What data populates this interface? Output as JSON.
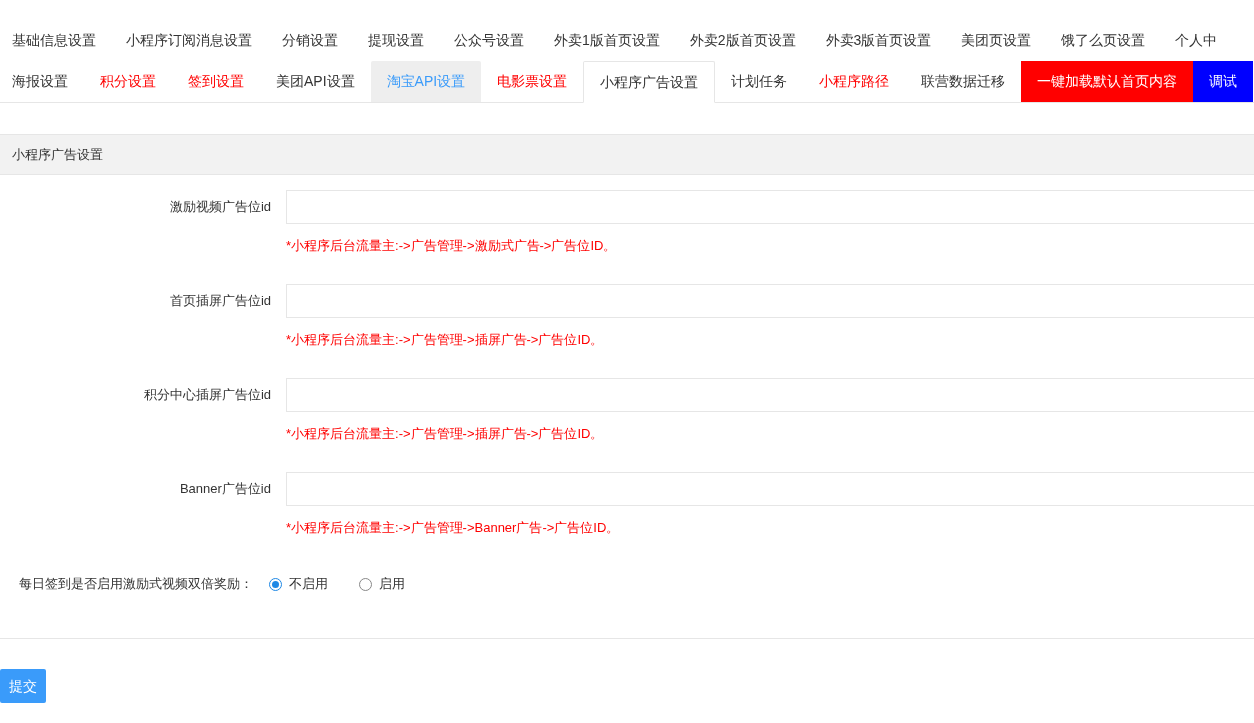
{
  "nav": {
    "rows": [
      {
        "tabs": [
          {
            "label": "基础信息设置",
            "kind": "plain",
            "selected": false
          },
          {
            "label": "小程序订阅消息设置",
            "kind": "plain",
            "selected": false
          },
          {
            "label": "分销设置",
            "kind": "plain",
            "selected": false
          },
          {
            "label": "提现设置",
            "kind": "plain",
            "selected": false
          },
          {
            "label": "公众号设置",
            "kind": "plain",
            "selected": false
          },
          {
            "label": "外卖1版首页设置",
            "kind": "plain",
            "selected": false
          },
          {
            "label": "外卖2版首页设置",
            "kind": "plain",
            "selected": false
          },
          {
            "label": "外卖3版首页设置",
            "kind": "plain",
            "selected": false
          },
          {
            "label": "美团页设置",
            "kind": "plain",
            "selected": false
          },
          {
            "label": "饿了么页设置",
            "kind": "plain",
            "selected": false
          },
          {
            "label": "个人中",
            "kind": "plain",
            "selected": false
          }
        ]
      },
      {
        "tabs": [
          {
            "label": "海报设置",
            "kind": "plain",
            "selected": false
          },
          {
            "label": "积分设置",
            "kind": "red",
            "selected": false
          },
          {
            "label": "签到设置",
            "kind": "red",
            "selected": false
          },
          {
            "label": "美团API设置",
            "kind": "plain",
            "selected": false
          },
          {
            "label": "淘宝API设置",
            "kind": "hover",
            "selected": false
          },
          {
            "label": "电影票设置",
            "kind": "red",
            "selected": false
          },
          {
            "label": "小程序广告设置",
            "kind": "plain",
            "selected": true
          },
          {
            "label": "计划任务",
            "kind": "plain",
            "selected": false
          },
          {
            "label": "小程序路径",
            "kind": "red",
            "selected": false
          },
          {
            "label": "联营数据迁移",
            "kind": "plain",
            "selected": false
          },
          {
            "label": "一键加载默认首页内容",
            "kind": "red-fill",
            "selected": false
          },
          {
            "label": "调试",
            "kind": "blue-fill",
            "selected": false
          }
        ]
      }
    ]
  },
  "panel": {
    "title": "小程序广告设置",
    "fields": [
      {
        "label": "激励视频广告位id",
        "hint": "*小程序后台流量主:->广告管理->激励式广告->广告位ID。"
      },
      {
        "label": "首页插屏广告位id",
        "hint": "*小程序后台流量主:->广告管理->插屏广告->广告位ID。"
      },
      {
        "label": "积分中心插屏广告位id",
        "hint": "*小程序后台流量主:->广告管理->插屏广告->广告位ID。"
      },
      {
        "label": "Banner广告位id",
        "hint": "*小程序后台流量主:->广告管理->Banner广告->广告位ID。"
      }
    ],
    "radio": {
      "label": "每日签到是否启用激励式视频双倍奖励：",
      "options": [
        {
          "label": "不启用",
          "selected": true
        },
        {
          "label": "启用",
          "selected": false
        }
      ]
    }
  },
  "submit_button": "提交"
}
